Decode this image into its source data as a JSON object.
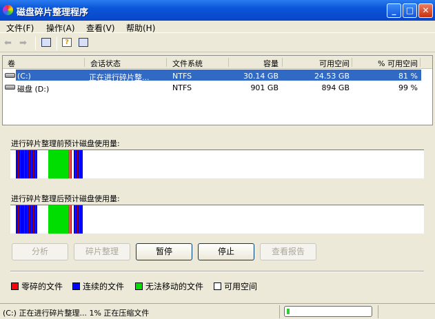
{
  "window": {
    "title": "磁盘碎片整理程序"
  },
  "menu": [
    "文件(F)",
    "操作(A)",
    "查看(V)",
    "帮助(H)"
  ],
  "columns": [
    "卷",
    "会话状态",
    "文件系统",
    "容量",
    "可用空间",
    "% 可用空间"
  ],
  "rows": [
    {
      "volume": "(C:)",
      "status": "正在进行碎片整...",
      "fs": "NTFS",
      "capacity": "30.14 GB",
      "free": "24.53 GB",
      "pct": "81 %",
      "selected": true
    },
    {
      "volume": "磁盘 (D:)",
      "status": "",
      "fs": "NTFS",
      "capacity": "901 GB",
      "free": "894 GB",
      "pct": "99 %",
      "selected": false
    }
  ],
  "maps": {
    "before_label": "进行碎片整理前预计磁盘使用量:",
    "after_label": "进行碎片整理后预计磁盘使用量:"
  },
  "buttons": {
    "analyze": "分析",
    "defrag": "碎片整理",
    "pause": "暂停",
    "stop": "停止",
    "report": "查看报告"
  },
  "legend": [
    {
      "label": "零碎的文件",
      "color": "#ff0000"
    },
    {
      "label": "连续的文件",
      "color": "#0000ff"
    },
    {
      "label": "无法移动的文件",
      "color": "#00e000"
    },
    {
      "label": "可用空间",
      "color": "#ffffff"
    }
  ],
  "statusbar": {
    "text": "(C:) 正在进行碎片整理... 1%  正在压缩文件",
    "progress_percent": 1
  }
}
